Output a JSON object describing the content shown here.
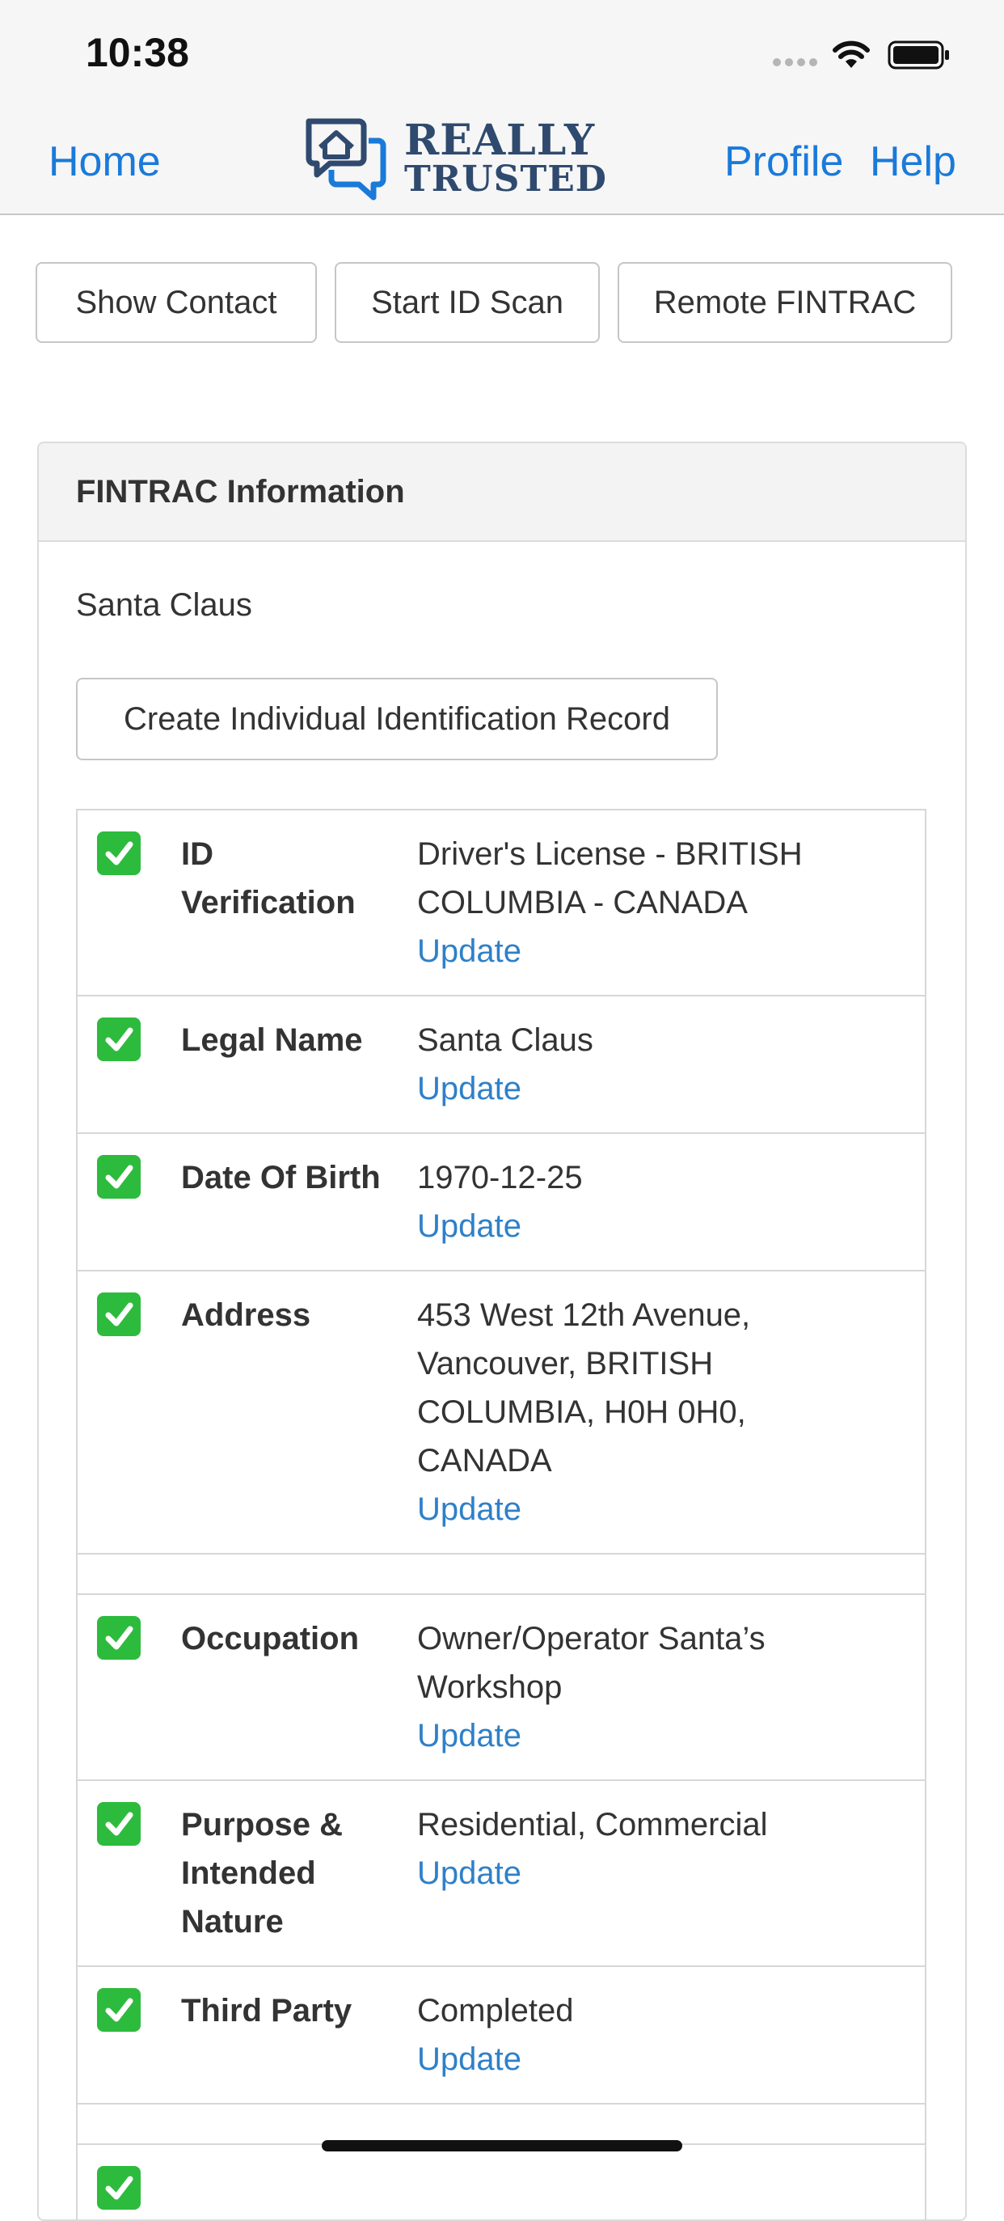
{
  "status_bar": {
    "time": "10:38"
  },
  "nav": {
    "home": "Home",
    "logo_line1": "REALLY",
    "logo_line2": "TRUSTED",
    "profile": "Profile",
    "help": "Help"
  },
  "actions": {
    "show_contact": "Show Contact",
    "start_id_scan": "Start ID Scan",
    "remote_fintrac": "Remote FINTRAC"
  },
  "panel": {
    "title": "FINTRAC Information",
    "client_name": "Santa Claus",
    "create_button": "Create Individual Identification Record",
    "rows": [
      {
        "label": "ID Verification",
        "value": "Driver's License - BRITISH COLUMBIA - CANADA",
        "action": "Update",
        "checked": true
      },
      {
        "label": "Legal Name",
        "value": "Santa Claus",
        "action": "Update",
        "checked": true
      },
      {
        "label": "Date Of Birth",
        "value": "1970-12-25",
        "action": "Update",
        "checked": true
      },
      {
        "label": "Address",
        "value": "453 West 12th Avenue, Vancouver, BRITISH COLUMBIA, H0H 0H0, CANADA",
        "action": "Update",
        "checked": true
      },
      {
        "label": "Occupation",
        "value": "Owner/Operator Santa’s Workshop",
        "action": "Update",
        "checked": true
      },
      {
        "label": "Purpose & Intended Nature",
        "value": "Residential, Commercial",
        "action": "Update",
        "checked": true
      },
      {
        "label": "Third Party",
        "value": "Completed",
        "action": "Update",
        "checked": true
      }
    ]
  },
  "colors": {
    "link": "#1a7ad9",
    "update_link": "#2f80c8",
    "check": "#2dbb3d",
    "logo": "#2f4a6e"
  }
}
